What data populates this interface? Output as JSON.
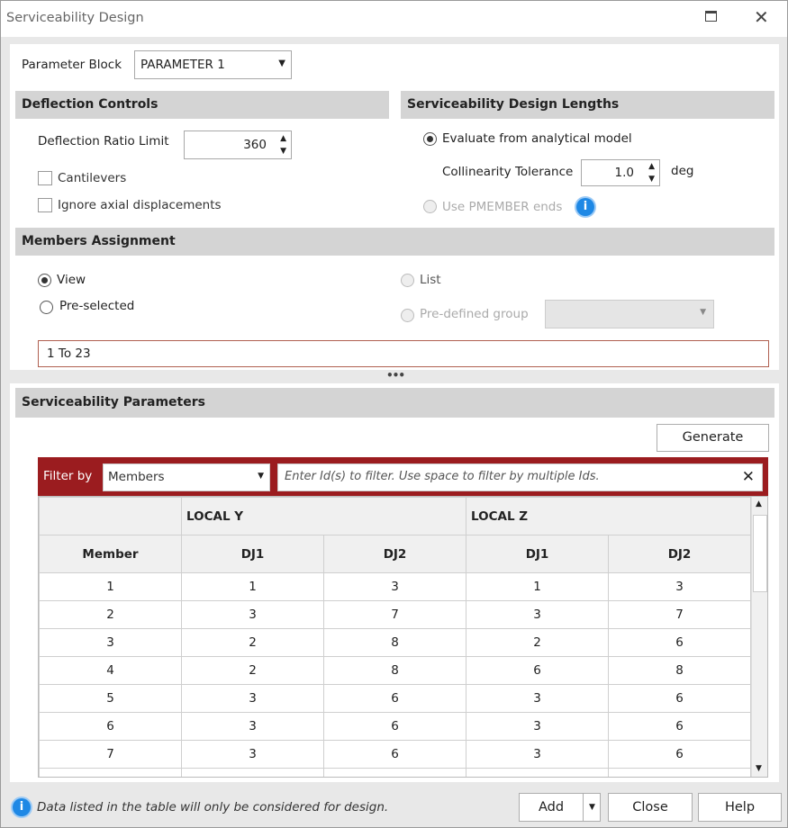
{
  "window": {
    "title": "Serviceability Design"
  },
  "parameter_block": {
    "label": "Parameter Block",
    "value": "PARAMETER 1"
  },
  "deflection": {
    "header": "Deflection Controls",
    "ratio_label": "Deflection Ratio Limit",
    "ratio_value": "360",
    "cantilevers": "Cantilevers",
    "ignore_axial": "Ignore axial displacements"
  },
  "lengths": {
    "header": "Serviceability Design Lengths",
    "evaluate": "Evaluate from analytical model",
    "collinearity_label": "Collinearity Tolerance",
    "collinearity_value": "1.0",
    "unit": "deg",
    "use_pmember": "Use PMEMBER ends"
  },
  "members": {
    "header": "Members Assignment",
    "view": "View",
    "preselected": "Pre-selected",
    "list": "List",
    "predefined": "Pre-defined group",
    "value": "1 To 23"
  },
  "params": {
    "header": "Serviceability Parameters",
    "generate": "Generate",
    "filter_label": "Filter by",
    "filter_value": "Members",
    "filter_placeholder": "Enter Id(s) to filter. Use space to filter by multiple Ids.",
    "group_headers": [
      "LOCAL Y",
      "LOCAL Z"
    ],
    "columns": [
      "Member",
      "DJ1",
      "DJ2",
      "DJ1",
      "DJ2"
    ],
    "rows": [
      [
        "1",
        "1",
        "3",
        "1",
        "3"
      ],
      [
        "2",
        "3",
        "7",
        "3",
        "7"
      ],
      [
        "3",
        "2",
        "8",
        "2",
        "6"
      ],
      [
        "4",
        "2",
        "8",
        "6",
        "8"
      ],
      [
        "5",
        "3",
        "6",
        "3",
        "6"
      ],
      [
        "6",
        "3",
        "6",
        "3",
        "6"
      ],
      [
        "7",
        "3",
        "6",
        "3",
        "6"
      ]
    ]
  },
  "footer": {
    "info": "Data listed in the table will only be considered for design.",
    "add": "Add",
    "close": "Close",
    "help": "Help"
  },
  "colors": {
    "filter_bar": "#9b1c1f",
    "info": "#1e88e5"
  }
}
